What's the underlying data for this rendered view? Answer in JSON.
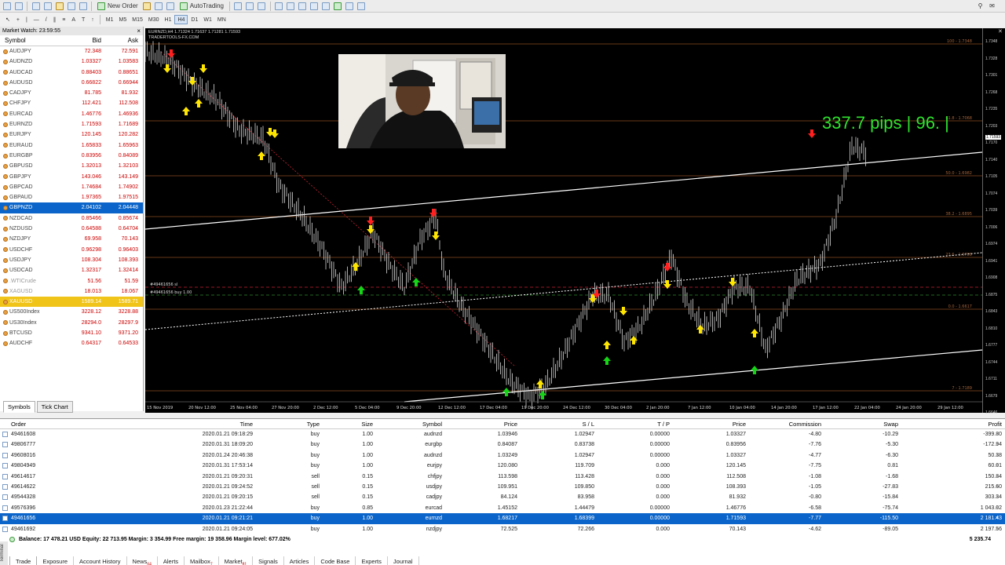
{
  "toolbar": {
    "new_order": "New Order",
    "autotrading": "AutoTrading",
    "timeframes": [
      "M1",
      "M5",
      "M15",
      "M30",
      "H1",
      "H4",
      "D1",
      "W1",
      "MN"
    ],
    "active_timeframe": "H4"
  },
  "market_watch": {
    "title": "Market Watch: 23:59:55",
    "col_symbol": "Symbol",
    "col_bid": "Bid",
    "col_ask": "Ask",
    "rows": [
      {
        "symbol": "AUDJPY",
        "bid": "72.348",
        "ask": "72.591"
      },
      {
        "symbol": "AUDNZD",
        "bid": "1.03327",
        "ask": "1.03583"
      },
      {
        "symbol": "AUDCAD",
        "bid": "0.88403",
        "ask": "0.88651"
      },
      {
        "symbol": "AUDUSD",
        "bid": "0.66822",
        "ask": "0.66944"
      },
      {
        "symbol": "CADJPY",
        "bid": "81.785",
        "ask": "81.932"
      },
      {
        "symbol": "CHFJPY",
        "bid": "112.421",
        "ask": "112.508"
      },
      {
        "symbol": "EURCAD",
        "bid": "1.46776",
        "ask": "1.46936"
      },
      {
        "symbol": "EURNZD",
        "bid": "1.71593",
        "ask": "1.71689"
      },
      {
        "symbol": "EURJPY",
        "bid": "120.145",
        "ask": "120.282"
      },
      {
        "symbol": "EURAUD",
        "bid": "1.65833",
        "ask": "1.65963"
      },
      {
        "symbol": "EURGBP",
        "bid": "0.83956",
        "ask": "0.84089"
      },
      {
        "symbol": "GBPUSD",
        "bid": "1.32013",
        "ask": "1.32103"
      },
      {
        "symbol": "GBPJPY",
        "bid": "143.046",
        "ask": "143.149"
      },
      {
        "symbol": "GBPCAD",
        "bid": "1.74684",
        "ask": "1.74902"
      },
      {
        "symbol": "GBPAUD",
        "bid": "1.97365",
        "ask": "1.97515"
      },
      {
        "symbol": "GBPNZD",
        "bid": "2.04102",
        "ask": "2.04448",
        "state": "sel"
      },
      {
        "symbol": "NZDCAD",
        "bid": "0.85466",
        "ask": "0.85674"
      },
      {
        "symbol": "NZDUSD",
        "bid": "0.64588",
        "ask": "0.64704"
      },
      {
        "symbol": "NZDJPY",
        "bid": "69.958",
        "ask": "70.143"
      },
      {
        "symbol": "USDCHF",
        "bid": "0.96298",
        "ask": "0.96403"
      },
      {
        "symbol": "USDJPY",
        "bid": "108.304",
        "ask": "108.393"
      },
      {
        "symbol": "USDCAD",
        "bid": "1.32317",
        "ask": "1.32414"
      },
      {
        "symbol": ".WTICrude",
        "bid": "51.56",
        "ask": "51.59",
        "state": "dim"
      },
      {
        "symbol": "XAGUSD",
        "bid": "18.013",
        "ask": "18.067",
        "state": "dim"
      },
      {
        "symbol": "XAUUSD",
        "bid": "1589.14",
        "ask": "1589.71",
        "state": "hl"
      },
      {
        "symbol": "US500Index",
        "bid": "3228.12",
        "ask": "3228.88"
      },
      {
        "symbol": "US30Index",
        "bid": "28294.0",
        "ask": "28297.9"
      },
      {
        "symbol": "BTCUSD",
        "bid": "9341.10",
        "ask": "9371.20"
      },
      {
        "symbol": "AUDCHF",
        "bid": "0.64317",
        "ask": "0.64533"
      }
    ],
    "tabs": [
      "Symbols",
      "Tick Chart"
    ]
  },
  "chart": {
    "header_line1": "EURNZD,H4  1.71324 1.71637 1.71281 1.71593",
    "header_line2": "TRADERTOOLS-FX.COM",
    "pips_label": "337.7 pips | 96. |",
    "order_label1": "#49461656 sl",
    "order_label2": "#49461656 buy 1.00",
    "fib_labels": [
      "100 - 1.7348",
      "61.8 - 1.7068",
      "50.0 - 1.6982",
      "38.2 - 1.6895",
      "23.6 - 1.6789",
      "0.0 - 1.6617",
      "7 - 1.7189"
    ],
    "x_labels": [
      "15 Nov 2019",
      "20 Nov 12:00",
      "25 Nov 04:00",
      "27 Nov 20:00",
      "2 Dec 12:00",
      "5 Dec 04:00",
      "9 Dec 20:00",
      "12 Dec 12:00",
      "17 Dec 04:00",
      "19 Dec 20:00",
      "24 Dec 12:00",
      "30 Dec 04:00",
      "2 Jan 20:00",
      "7 Jan 12:00",
      "10 Jan 04:00",
      "14 Jan 20:00",
      "17 Jan 12:00",
      "22 Jan 04:00",
      "24 Jan 20:00",
      "29 Jan 12:00"
    ],
    "y_labels": [
      "1.7348",
      "1.7328",
      "1.7301",
      "1.7268",
      "1.7235",
      "1.7203",
      "1.7170",
      "1.7140",
      "1.7105",
      "1.7074",
      "1.7039",
      "1.7006",
      "1.6974",
      "1.6941",
      "1.6908",
      "1.6875",
      "1.6843",
      "1.6810",
      "1.6777",
      "1.6744",
      "1.6711",
      "1.6679",
      "1.6646",
      "1.6613"
    ],
    "price_tag": "1.71593",
    "colors": {
      "bg": "#000000",
      "candle": "#d8d8d8",
      "up_arrow": "#ffe600",
      "down_arrow": "#ff2020",
      "green_arrow": "#17d317",
      "trendline": "#ffffff",
      "fib": "#8b4a20",
      "pips": "#2ee42e"
    }
  },
  "terminal": {
    "headers": {
      "order": "Order",
      "time": "Time",
      "type": "Type",
      "size": "Size",
      "symbol": "Symbol",
      "price": "Price",
      "sl": "S / L",
      "tp": "T / P",
      "price2": "Price",
      "commission": "Commission",
      "swap": "Swap",
      "profit": "Profit"
    },
    "rows": [
      {
        "order": "49461608",
        "time": "2020.01.21 09:18:29",
        "type": "buy",
        "size": "1.00",
        "symbol": "audnzd",
        "price": "1.03946",
        "sl": "1.02947",
        "tp": "0.00000",
        "price2": "1.03327",
        "commission": "-4.80",
        "swap": "-10.29",
        "profit": "-399.80"
      },
      {
        "order": "49806777",
        "time": "2020.01.31 18:09:20",
        "type": "buy",
        "size": "1.00",
        "symbol": "eurgbp",
        "price": "0.84087",
        "sl": "0.83738",
        "tp": "0.00000",
        "price2": "0.83956",
        "commission": "-7.76",
        "swap": "-5.30",
        "profit": "-172.94"
      },
      {
        "order": "49608016",
        "time": "2020.01.24 20:46:38",
        "type": "buy",
        "size": "1.00",
        "symbol": "audnzd",
        "price": "1.03249",
        "sl": "1.02947",
        "tp": "0.00000",
        "price2": "1.03327",
        "commission": "-4.77",
        "swap": "-6.30",
        "profit": "50.38"
      },
      {
        "order": "49804949",
        "time": "2020.01.31 17:53:14",
        "type": "buy",
        "size": "1.00",
        "symbol": "eurjpy",
        "price": "120.080",
        "sl": "119.709",
        "tp": "0.000",
        "price2": "120.145",
        "commission": "-7.75",
        "swap": "0.81",
        "profit": "60.01"
      },
      {
        "order": "49614617",
        "time": "2020.01.21 09:20:31",
        "type": "sell",
        "size": "0.15",
        "symbol": "chfjpy",
        "price": "113.598",
        "sl": "113.428",
        "tp": "0.000",
        "price2": "112.508",
        "commission": "-1.08",
        "swap": "-1.68",
        "profit": "150.84"
      },
      {
        "order": "49614622",
        "time": "2020.01.21 09:24:52",
        "type": "sell",
        "size": "0.15",
        "symbol": "usdjpy",
        "price": "109.951",
        "sl": "109.850",
        "tp": "0.000",
        "price2": "108.393",
        "commission": "-1.05",
        "swap": "-27.83",
        "profit": "215.60"
      },
      {
        "order": "49544328",
        "time": "2020.01.21 09:20:15",
        "type": "sell",
        "size": "0.15",
        "symbol": "cadjpy",
        "price": "84.124",
        "sl": "83.958",
        "tp": "0.000",
        "price2": "81.932",
        "commission": "-0.80",
        "swap": "-15.84",
        "profit": "303.34"
      },
      {
        "order": "49576396",
        "time": "2020.01.23 21:22:44",
        "type": "buy",
        "size": "0.85",
        "symbol": "eurcad",
        "price": "1.45152",
        "sl": "1.44479",
        "tp": "0.00000",
        "price2": "1.46776",
        "commission": "-6.58",
        "swap": "-75.74",
        "profit": "1 043.02"
      },
      {
        "order": "49461656",
        "time": "2020.01.21 09:21:21",
        "type": "buy",
        "size": "1.00",
        "symbol": "eurnzd",
        "price": "1.68217",
        "sl": "1.68399",
        "tp": "0.00000",
        "price2": "1.71593",
        "commission": "-7.77",
        "swap": "-115.50",
        "profit": "2 181.43",
        "selected": true
      },
      {
        "order": "49461692",
        "time": "2020.01.21 09:24:05",
        "type": "buy",
        "size": "1.00",
        "symbol": "nzdjpy",
        "price": "72.525",
        "sl": "72.266",
        "tp": "0.000",
        "price2": "70.143",
        "commission": "-4.62",
        "swap": "-89.05",
        "profit": "2 197.56"
      }
    ],
    "balance_line": "Balance: 17 478.21 USD  Equity: 22 713.95  Margin: 3 354.99  Free margin: 19 358.96  Margin level: 677.02%",
    "balance_total": "5 235.74",
    "tabs": [
      {
        "label": "Trade"
      },
      {
        "label": "Exposure"
      },
      {
        "label": "Account History"
      },
      {
        "label": "News",
        "badge": "64"
      },
      {
        "label": "Alerts"
      },
      {
        "label": "Mailbox",
        "badge": "7"
      },
      {
        "label": "Market",
        "badge": "81"
      },
      {
        "label": "Signals"
      },
      {
        "label": "Articles"
      },
      {
        "label": "Code Base"
      },
      {
        "label": "Experts"
      },
      {
        "label": "Journal"
      }
    ],
    "side_label": "Terminal"
  }
}
